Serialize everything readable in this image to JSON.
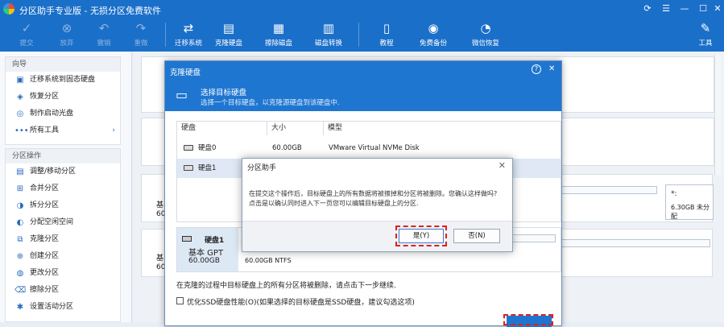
{
  "app": {
    "title": "分区助手专业版 - 无损分区免费软件"
  },
  "toolbar": {
    "submit": "提交",
    "discard": "放弃",
    "undo": "撤销",
    "redo": "重做",
    "migrate": "迁移系统",
    "clone_disk": "克隆硬盘",
    "wipe_disk": "擦除磁盘",
    "convert_disk": "磁盘转换",
    "tutorial": "教程",
    "free_backup": "免费备份",
    "wechat_restore": "微信恢复",
    "tools": "工具"
  },
  "sidebar": {
    "wizard_header": "向导",
    "wizard_items": [
      "迁移系统到固态硬盘",
      "恢复分区",
      "制作启动光盘",
      "所有工具"
    ],
    "partition_header": "分区操作",
    "partition_items": [
      "调整/移动分区",
      "合并分区",
      "拆分分区",
      "分配空闲空间",
      "克隆分区",
      "创建分区",
      "更改分区",
      "擦除分区",
      "设置活动分区"
    ]
  },
  "main": {
    "disk_a_type": "基",
    "disk_a_size": "60",
    "disk_b_type": "基",
    "disk_b_size": "60",
    "right_label": "*:",
    "right_size": "6.30GB 未分配"
  },
  "dialog": {
    "title": "克隆硬盘",
    "help": "?",
    "close": "✕",
    "banner_title": "选择目标硬盘",
    "banner_sub": "选择一个目标硬盘，以克隆源硬盘到该硬盘中.",
    "columns": [
      "硬盘",
      "大小",
      "模型"
    ],
    "rows": [
      {
        "disk": "硬盘0",
        "size": "60.00GB",
        "model": "VMware Virtual NVMe Disk"
      },
      {
        "disk": "硬盘1",
        "size": "",
        "model": ""
      }
    ],
    "target_name": "硬盘1",
    "target_type": "基本 GPT",
    "target_size": "60.00GB",
    "target_partition": "60.00GB NTFS",
    "warning": "在克隆的过程中目标硬盘上的所有分区将被删除，请点击下一步继续.",
    "ssd_option": "优化SSD硬盘性能(O)(如果选择的目标硬盘是SSD硬盘，建议勾选这项)"
  },
  "confirm": {
    "title": "分区助手",
    "close": "✕",
    "message1": "在提交这个操作后，目标硬盘上的所有数据将被擦掉和分区将被删除。您确认这样做吗?",
    "message2": "点击是以确认同时进入下一页您可以编辑目标硬盘上的分区.",
    "yes": "是(Y)",
    "no": "否(N)"
  },
  "colors": {
    "accent": "#1a6fc9",
    "highlight": "#e0201a"
  }
}
